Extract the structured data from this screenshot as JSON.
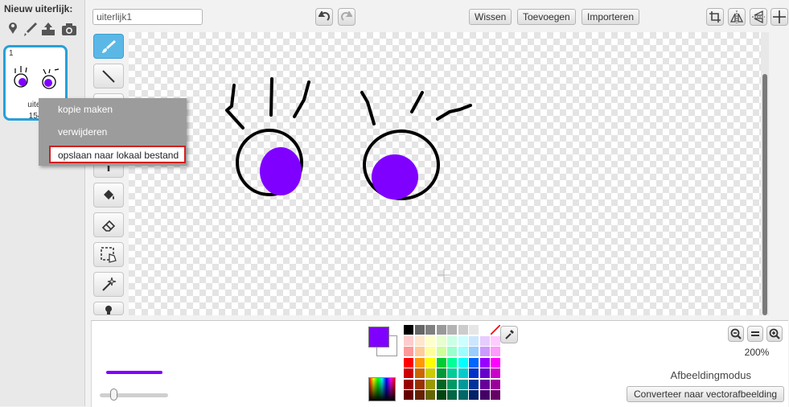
{
  "costumes": {
    "new_label": "Nieuw uiterlijk:",
    "new_icons": [
      "sprite-library-icon",
      "paint-brush-icon",
      "upload-icon",
      "camera-icon"
    ],
    "items": [
      {
        "number": "1",
        "name": "uiter",
        "size": "154"
      }
    ]
  },
  "context_menu": {
    "items": [
      {
        "label": "kopie maken",
        "highlighted": false
      },
      {
        "label": "verwijderen",
        "highlighted": false
      },
      {
        "label": "opslaan naar lokaal bestand",
        "highlighted": true
      }
    ],
    "highlight_color": "#d2201c"
  },
  "toolbar": {
    "costume_name": "uiterlijk1",
    "undo_icon": "undo-icon",
    "redo_icon": "redo-icon",
    "clear_label": "Wissen",
    "add_label": "Toevoegen",
    "import_label": "Importeren",
    "right_icons": [
      "crop-icon",
      "flip-horizontal-icon",
      "flip-vertical-icon",
      "set-center-icon"
    ]
  },
  "tools": [
    {
      "name": "brush-icon",
      "active": true
    },
    {
      "name": "line-icon",
      "active": false
    },
    {
      "name": "rectangle-icon",
      "active": false
    },
    {
      "name": "ellipse-icon",
      "active": false
    },
    {
      "name": "text-icon",
      "active": false
    },
    {
      "name": "fill-bucket-icon",
      "active": false
    },
    {
      "name": "eraser-icon",
      "active": false
    },
    {
      "name": "select-icon",
      "active": false
    },
    {
      "name": "magic-wand-icon",
      "active": false
    },
    {
      "name": "stamp-icon",
      "active": false
    }
  ],
  "colors": {
    "accent": "#27a0d8",
    "primary": "#8000ff",
    "secondary": "#ffffff",
    "outline": "#000000"
  },
  "palette": [
    [
      "#000000",
      "#666666",
      "#808080",
      "#999999",
      "#b3b3b3",
      "#cccccc",
      "#e6e6e6",
      "#ffffff",
      "transparent"
    ],
    [
      "#ffcccc",
      "#ffe6cc",
      "#ffffcc",
      "#e6ffcc",
      "#ccffe6",
      "#ccffff",
      "#cce6ff",
      "#e6ccff",
      "#ffccff"
    ],
    [
      "#ff9999",
      "#ffcc99",
      "#ffff99",
      "#ccff99",
      "#99ffcc",
      "#99ffff",
      "#99ccff",
      "#cc99ff",
      "#ff99ff"
    ],
    [
      "#ff0000",
      "#ff9900",
      "#ffff00",
      "#00cc33",
      "#00ff99",
      "#00ffff",
      "#0066ff",
      "#9900ff",
      "#ff00ff"
    ],
    [
      "#cc0000",
      "#cc6600",
      "#cccc00",
      "#009933",
      "#00cc99",
      "#00cccc",
      "#0033cc",
      "#6600cc",
      "#cc00cc"
    ],
    [
      "#990000",
      "#993300",
      "#999900",
      "#006622",
      "#009966",
      "#009999",
      "#003399",
      "#660099",
      "#990099"
    ],
    [
      "#660000",
      "#662200",
      "#666600",
      "#004411",
      "#006644",
      "#006666",
      "#002266",
      "#440066",
      "#660066"
    ]
  ],
  "zoom": {
    "level": "200%",
    "out_icon": "zoom-out-icon",
    "reset_icon": "zoom-reset-icon",
    "in_icon": "zoom-in-icon"
  },
  "mode": {
    "label": "Afbeeldingmodus",
    "convert_label": "Converteer naar vectorafbeelding"
  }
}
